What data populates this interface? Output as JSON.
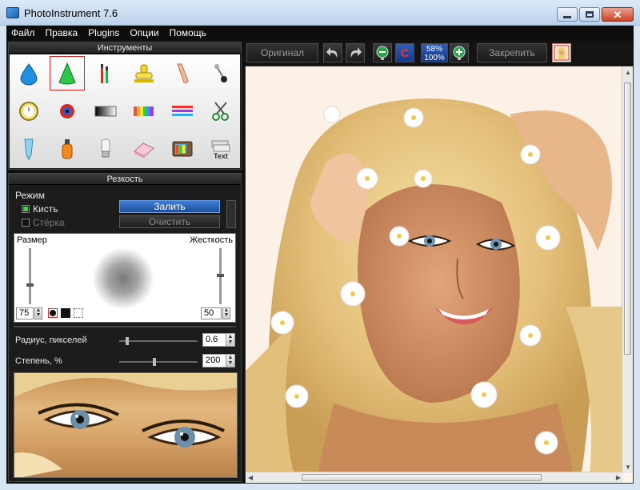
{
  "window": {
    "title": "PhotoInstrument 7.6"
  },
  "menu": [
    "Файл",
    "Правка",
    "Plugins",
    "Опции",
    "Помощь"
  ],
  "tools_panel": {
    "title": "Инструменты",
    "tools": [
      {
        "name": "drop-icon"
      },
      {
        "name": "cone-icon",
        "selected": true
      },
      {
        "name": "brushes-icon"
      },
      {
        "name": "stamp-icon"
      },
      {
        "name": "finger-icon"
      },
      {
        "name": "pin-icon"
      },
      {
        "name": "clock-icon"
      },
      {
        "name": "red-eye-icon"
      },
      {
        "name": "gradient-icon"
      },
      {
        "name": "color-bars-icon"
      },
      {
        "name": "lines-icon"
      },
      {
        "name": "scissors-icon"
      },
      {
        "name": "tube-icon"
      },
      {
        "name": "bottle-icon"
      },
      {
        "name": "bulb-icon"
      },
      {
        "name": "eraser-icon"
      },
      {
        "name": "tv-icon"
      },
      {
        "name": "text-icon"
      }
    ]
  },
  "sharpness_panel": {
    "title": "Резкость",
    "mode_label": "Режим",
    "brush_label": "Кисть",
    "eraser_label": "Стёрка",
    "fill_button": "Залить",
    "clear_button": "Очистить",
    "size_label": "Размер",
    "hardness_label": "Жесткость",
    "size_value": "75",
    "hardness_value": "50",
    "radius_label": "Радиус, пикселей",
    "radius_value": "0.6",
    "degree_label": "Степень, %",
    "degree_value": "200"
  },
  "toolbar": {
    "original_label": "Оригинал",
    "pin_label": "Закрепить",
    "zoom_top": "58%",
    "zoom_bottom": "100%"
  },
  "colors": {
    "accent": "#2a6bd0",
    "chrome": "#111111"
  }
}
